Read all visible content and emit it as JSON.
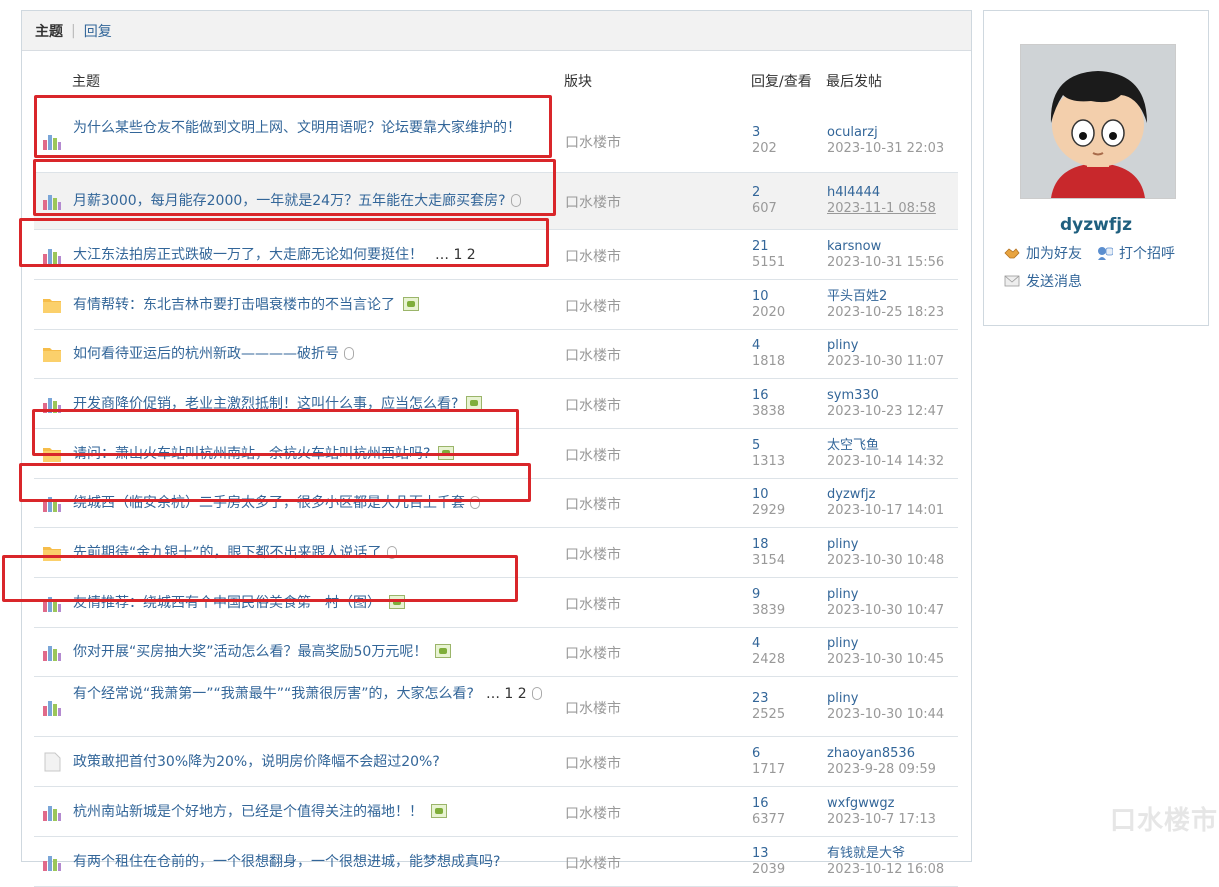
{
  "tabs": {
    "active": "主题",
    "other": "回复"
  },
  "headers": {
    "title": "主题",
    "forum": "版块",
    "stats": "回复/查看",
    "last": "最后发帖"
  },
  "rows": [
    {
      "icon": "bar-chart-icon",
      "title": "为什么某些仓友不能做到文明上网、文明用语呢？论坛要靠大家维护的！",
      "forum": "口水楼市",
      "replies": "3",
      "views": "202",
      "user": "ocularzj",
      "time": "2023-10-31 22:03"
    },
    {
      "icon": "bar-chart-icon",
      "title": "月薪3000，每月能存2000，一年就是24万？五年能在大走廊买套房?",
      "forum": "口水楼市",
      "replies": "2",
      "views": "607",
      "user": "h4l4444",
      "time": "2023-11-1 08:58"
    },
    {
      "icon": "bar-chart-icon",
      "title": "大江东法拍房正式跌破一万了，大走廊无论如何要挺住！",
      "pages": "… 1 2",
      "forum": "口水楼市",
      "replies": "21",
      "views": "5151",
      "user": "karsnow",
      "time": "2023-10-31 15:56"
    },
    {
      "icon": "folder-icon",
      "title": "有情帮转：东北吉林市要打击唱衰楼市的不当言论了",
      "forum": "口水楼市",
      "replies": "10",
      "views": "2020",
      "user": "平头百姓2",
      "time": "2023-10-25 18:23"
    },
    {
      "icon": "folder-icon",
      "title": "如何看待亚运后的杭州新政————破折号",
      "forum": "口水楼市",
      "replies": "4",
      "views": "1818",
      "user": "pliny",
      "time": "2023-10-30 11:07"
    },
    {
      "icon": "bar-chart-icon",
      "title": "开发商降价促销，老业主激烈抵制！这叫什么事，应当怎么看?",
      "forum": "口水楼市",
      "replies": "16",
      "views": "3838",
      "user": "sym330",
      "time": "2023-10-23 12:47"
    },
    {
      "icon": "folder-icon",
      "title": "请问：萧山火车站叫杭州南站，余杭火车站叫杭州西站吗?",
      "forum": "口水楼市",
      "replies": "5",
      "views": "1313",
      "user": "太空飞鱼",
      "time": "2023-10-14 14:32"
    },
    {
      "icon": "bar-chart-icon",
      "title": "绕城西（临安余杭）二手房太多了，很多小区都是大几百上千套",
      "forum": "口水楼市",
      "replies": "10",
      "views": "2929",
      "user": "dyzwfjz",
      "time": "2023-10-17 14:01"
    },
    {
      "icon": "folder-icon",
      "title": "先前期待“金九银十”的，眼下都不出来跟人说话了",
      "forum": "口水楼市",
      "replies": "18",
      "views": "3154",
      "user": "pliny",
      "time": "2023-10-30 10:48"
    },
    {
      "icon": "bar-chart-icon",
      "title": "友情推荐：绕城西有个中国民俗美食第一村（图）",
      "forum": "口水楼市",
      "replies": "9",
      "views": "3839",
      "user": "pliny",
      "time": "2023-10-30 10:47"
    },
    {
      "icon": "bar-chart-icon",
      "title": "你对开展“买房抽大奖”活动怎么看？最高奖励50万元呢！",
      "forum": "口水楼市",
      "replies": "4",
      "views": "2428",
      "user": "pliny",
      "time": "2023-10-30 10:45"
    },
    {
      "icon": "bar-chart-icon",
      "title": "有个经常说“我萧第一”“我萧最牛”“我萧很厉害”的，大家怎么看?",
      "pages": "… 1 2",
      "forum": "口水楼市",
      "replies": "23",
      "views": "2525",
      "user": "pliny",
      "time": "2023-10-30 10:44"
    },
    {
      "icon": "doc-icon",
      "title": "政策敢把首付30%降为20%，说明房价降幅不会超过20%?",
      "forum": "口水楼市",
      "replies": "6",
      "views": "1717",
      "user": "zhaoyan8536",
      "time": "2023-9-28 09:59"
    },
    {
      "icon": "bar-chart-icon",
      "title": "杭州南站新城是个好地方，已经是个值得关注的福地！！",
      "forum": "口水楼市",
      "replies": "16",
      "views": "6377",
      "user": "wxfgwwgz",
      "time": "2023-10-7 17:13"
    },
    {
      "icon": "bar-chart-icon",
      "title": "有两个租住在仓前的，一个很想翻身，一个很想进城，能梦想成真吗?",
      "forum": "口水楼市",
      "replies": "13",
      "views": "2039",
      "user": "有钱就是大爷",
      "time": "2023-10-12 16:08"
    }
  ],
  "profile": {
    "username": "dyzwfjz",
    "add_friend": "加为好友",
    "say_hi": "打个招呼",
    "send_message": "发送消息"
  },
  "watermark": "口水楼市"
}
